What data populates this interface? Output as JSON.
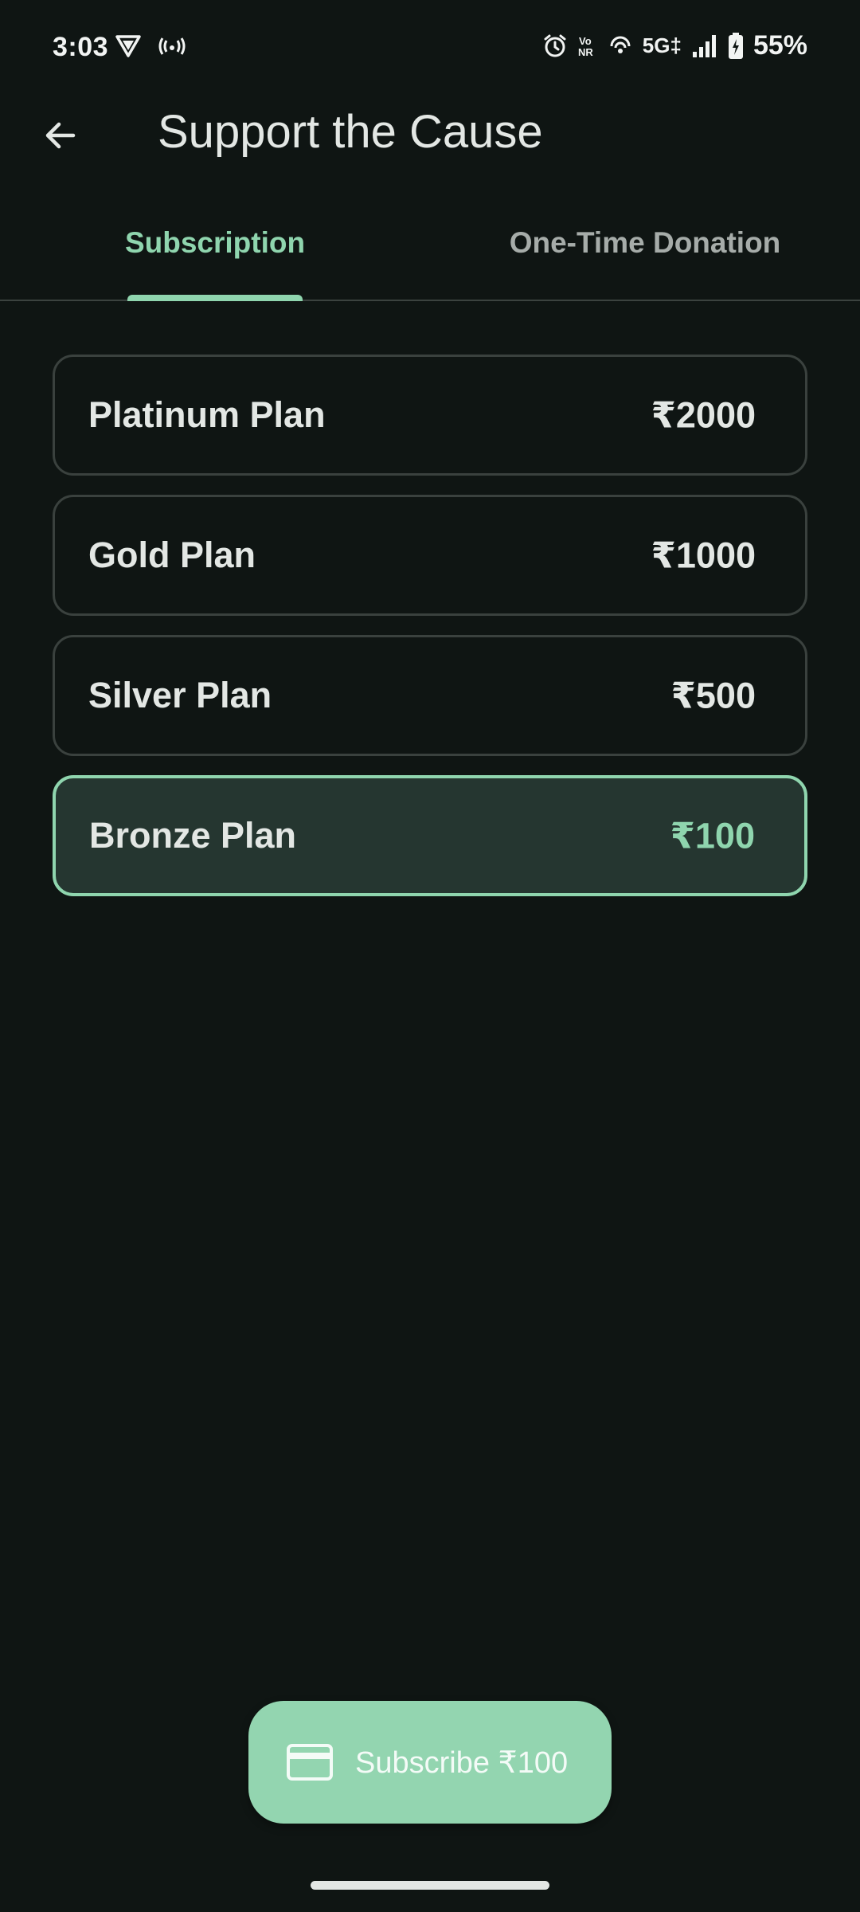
{
  "status_bar": {
    "time": "3:03",
    "network": "5G‡",
    "battery": "55%",
    "icons": [
      "vpn-shield-icon",
      "hotspot-icon",
      "alarm-icon",
      "vonr-icon",
      "wifi-calling-icon",
      "signal-icon",
      "battery-charging-icon"
    ]
  },
  "app_bar": {
    "title": "Support the Cause",
    "back_icon": "arrow-back-icon"
  },
  "tabs": [
    {
      "label": "Subscription",
      "selected": true
    },
    {
      "label": "One-Time Donation",
      "selected": false
    }
  ],
  "plans": [
    {
      "name": "Platinum Plan",
      "price": "₹2000",
      "selected": false
    },
    {
      "name": "Gold Plan",
      "price": "₹1000",
      "selected": false
    },
    {
      "name": "Silver Plan",
      "price": "₹500",
      "selected": false
    },
    {
      "name": "Bronze Plan",
      "price": "₹100",
      "selected": true
    }
  ],
  "subscribe_button": {
    "label": "Subscribe ₹100",
    "icon": "credit-card-icon"
  },
  "colors": {
    "background": "#0f1513",
    "accent": "#8fd5ae",
    "selected_card": "#253630",
    "card_border": "#3a413e"
  }
}
